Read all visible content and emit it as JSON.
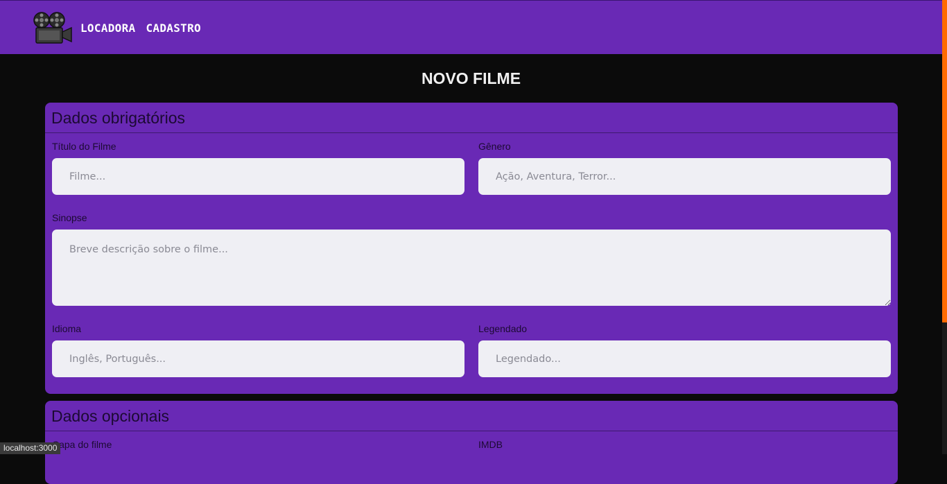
{
  "nav": {
    "logo_icon": "film-projector-icon",
    "links": [
      "LOCADORA",
      "CADASTRO"
    ]
  },
  "page": {
    "title": "NOVO FILME"
  },
  "required_section": {
    "title": "Dados obrigatórios",
    "fields": {
      "titulo": {
        "label": "Título do Filme",
        "placeholder": "Filme..."
      },
      "genero": {
        "label": "Gênero",
        "placeholder": "Ação, Aventura, Terror..."
      },
      "sinopse": {
        "label": "Sinopse",
        "placeholder": "Breve descrição sobre o filme..."
      },
      "idioma": {
        "label": "Idioma",
        "placeholder": "Inglês, Português..."
      },
      "legendado": {
        "label": "Legendado",
        "placeholder": "Legendado..."
      }
    }
  },
  "optional_section": {
    "title": "Dados opcionais",
    "fields": {
      "capa": {
        "label": "Capa do filme"
      },
      "imdb": {
        "label": "IMDB"
      }
    }
  },
  "status_bar": {
    "url": "localhost:3000"
  },
  "colors": {
    "primary": "#6929b5",
    "background": "#0b0b0b",
    "scrollbar": "#ff6a00"
  }
}
